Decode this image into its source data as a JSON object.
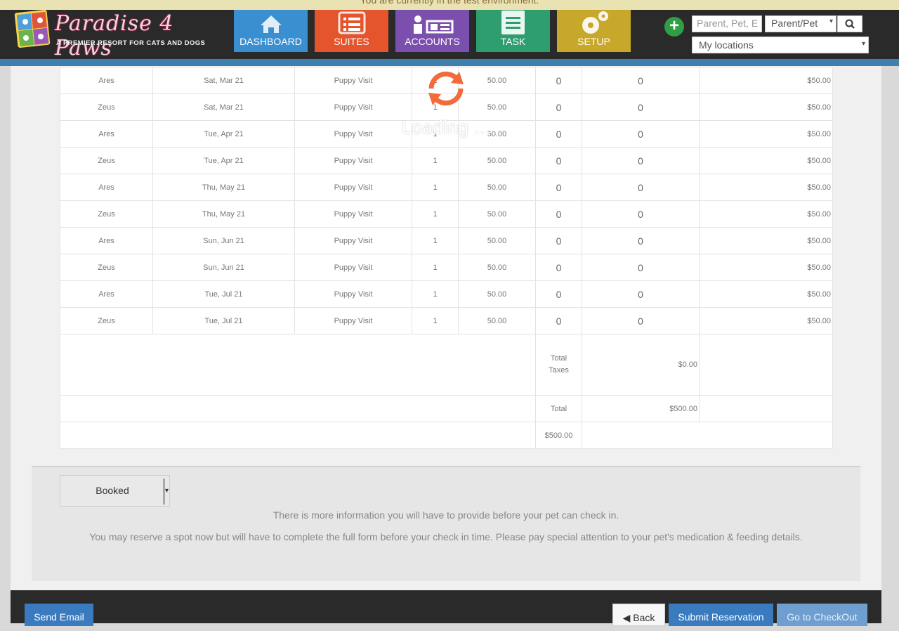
{
  "banner": {
    "text": "You are currently in the test environment."
  },
  "brand": {
    "name": "Paradise 4 Paws",
    "tagline": "A PREMIER RESORT FOR CATS AND DOGS"
  },
  "nav": [
    {
      "label": "DASHBOARD",
      "color": "#3a8fd0"
    },
    {
      "label": "SUITES",
      "color": "#e4542d"
    },
    {
      "label": "ACCOUNTS",
      "color": "#7b4fae"
    },
    {
      "label": "TASK",
      "color": "#2e9e6f"
    },
    {
      "label": "SETUP",
      "color": "#c8a82a"
    }
  ],
  "search": {
    "placeholder": "Parent, Pet, E",
    "type_value": "Parent/Pet",
    "location_value": "My locations"
  },
  "table": {
    "rows": [
      {
        "pet": "Ares",
        "date": "Sat, Mar 21",
        "service": "Puppy Visit",
        "qty": "1",
        "rate": "50.00",
        "a": "0",
        "b": "0",
        "total": "$50.00"
      },
      {
        "pet": "Zeus",
        "date": "Sat, Mar 21",
        "service": "Puppy Visit",
        "qty": "1",
        "rate": "50.00",
        "a": "0",
        "b": "0",
        "total": "$50.00"
      },
      {
        "pet": "Ares",
        "date": "Tue, Apr 21",
        "service": "Puppy Visit",
        "qty": "1",
        "rate": "50.00",
        "a": "0",
        "b": "0",
        "total": "$50.00"
      },
      {
        "pet": "Zeus",
        "date": "Tue, Apr 21",
        "service": "Puppy Visit",
        "qty": "1",
        "rate": "50.00",
        "a": "0",
        "b": "0",
        "total": "$50.00"
      },
      {
        "pet": "Ares",
        "date": "Thu, May 21",
        "service": "Puppy Visit",
        "qty": "1",
        "rate": "50.00",
        "a": "0",
        "b": "0",
        "total": "$50.00"
      },
      {
        "pet": "Zeus",
        "date": "Thu, May 21",
        "service": "Puppy Visit",
        "qty": "1",
        "rate": "50.00",
        "a": "0",
        "b": "0",
        "total": "$50.00"
      },
      {
        "pet": "Ares",
        "date": "Sun, Jun 21",
        "service": "Puppy Visit",
        "qty": "1",
        "rate": "50.00",
        "a": "0",
        "b": "0",
        "total": "$50.00"
      },
      {
        "pet": "Zeus",
        "date": "Sun, Jun 21",
        "service": "Puppy Visit",
        "qty": "1",
        "rate": "50.00",
        "a": "0",
        "b": "0",
        "total": "$50.00"
      },
      {
        "pet": "Ares",
        "date": "Tue, Jul 21",
        "service": "Puppy Visit",
        "qty": "1",
        "rate": "50.00",
        "a": "0",
        "b": "0",
        "total": "$50.00"
      },
      {
        "pet": "Zeus",
        "date": "Tue, Jul 21",
        "service": "Puppy Visit",
        "qty": "1",
        "rate": "50.00",
        "a": "0",
        "b": "0",
        "total": "$50.00"
      }
    ],
    "total_taxes_label": "Total Taxes",
    "total_taxes_value": "$0.00",
    "total_label": "Total",
    "total_value": "$500.00",
    "grand_total": "$500.00"
  },
  "status": {
    "value": "Booked"
  },
  "messages": {
    "line1": "There is more information you will have to provide before your pet can check in.",
    "line2": "You may reserve a spot now but will have to complete the full form before your check in time. Please pay special attention to your pet's medication & feeding details."
  },
  "footer": {
    "send_email": "Send Email",
    "back": "Back",
    "submit": "Submit Reservation",
    "checkout": "Go to CheckOut"
  },
  "loading": {
    "text": "Loading ...",
    "icon": "refresh-icon",
    "color": "#f26b3a"
  }
}
